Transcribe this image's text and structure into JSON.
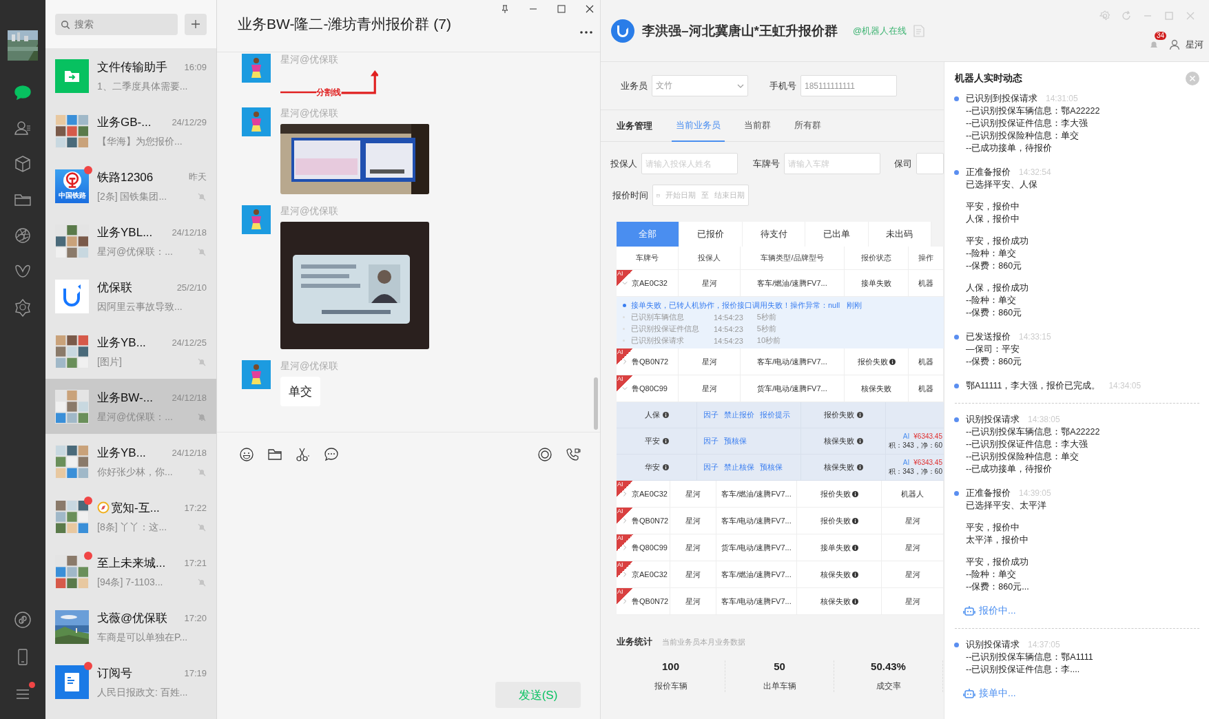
{
  "nav": {
    "items": [
      {
        "kind": "chat",
        "selected": true
      },
      {
        "kind": "contacts",
        "selected": false
      },
      {
        "kind": "cube",
        "selected": false
      },
      {
        "kind": "folder",
        "selected": false
      },
      {
        "kind": "aperture",
        "selected": false
      },
      {
        "kind": "butterfly",
        "selected": false
      },
      {
        "kind": "hexagon",
        "selected": false
      }
    ],
    "bottom": [
      {
        "kind": "link",
        "dot": false
      },
      {
        "kind": "phone",
        "dot": false
      },
      {
        "kind": "menu",
        "dot": true
      }
    ]
  },
  "chat_list": {
    "search": {
      "placeholder": "搜索"
    },
    "items": [
      {
        "name": "文件传输助手",
        "time": "16:09",
        "preview": "1、二季度具体需要...",
        "kind": "file",
        "muted": false,
        "unread": false,
        "selected": false,
        "compass": false
      },
      {
        "name": "业务GB-...",
        "time": "24/12/29",
        "preview": "【华海】为您报价...",
        "kind": "mosaic",
        "muted": false,
        "unread": false,
        "selected": false,
        "compass": false
      },
      {
        "name": "铁路12306",
        "time": "昨天",
        "preview": "[2条] 国铁集团...",
        "kind": "rail",
        "avatar_text": "中国铁路",
        "muted": true,
        "unread": true,
        "selected": false,
        "compass": false
      },
      {
        "name": "业务YBL...",
        "time": "24/12/18",
        "preview": "星河@优保联：...",
        "kind": "mosaic",
        "muted": true,
        "unread": false,
        "selected": false,
        "compass": false
      },
      {
        "name": "优保联",
        "time": "25/2/10",
        "preview": "因阿里云事故导致...",
        "kind": "brand",
        "muted": false,
        "unread": false,
        "selected": false,
        "compass": false
      },
      {
        "name": "业务YB...",
        "time": "24/12/25",
        "preview": "[图片]",
        "kind": "mosaic",
        "muted": true,
        "unread": false,
        "selected": false,
        "compass": false
      },
      {
        "name": "业务BW-...",
        "time": "24/12/18",
        "preview": "星河@优保联：...",
        "kind": "mosaic",
        "muted": true,
        "unread": false,
        "selected": true,
        "compass": false
      },
      {
        "name": "业务YB...",
        "time": "24/12/18",
        "preview": "你好张少林，你...",
        "kind": "mosaic",
        "muted": true,
        "unread": false,
        "selected": false,
        "compass": false
      },
      {
        "name": "宽知-互...",
        "time": "17:22",
        "preview": "[8条] 丫丫：这...",
        "kind": "mosaic",
        "muted": true,
        "unread": true,
        "selected": false,
        "compass": true
      },
      {
        "name": "至上未来城...",
        "time": "17:21",
        "preview": "[94条] 7-1103...",
        "kind": "mosaic",
        "muted": true,
        "unread": true,
        "selected": false,
        "compass": false
      },
      {
        "name": "戈薇@优保联",
        "time": "17:20",
        "preview": "车商是可以单独在P...",
        "muted": false,
        "unread": false,
        "selected": false,
        "compass": false
      },
      {
        "name": "订阅号",
        "time": "17:19",
        "preview": "人民日报政文: 百姓...",
        "kind": "doc",
        "muted": false,
        "unread": true,
        "selected": false,
        "compass": false
      }
    ]
  },
  "chat": {
    "title": "业务BW-隆二-潍坊青州报价群 (7)",
    "messages": [
      {
        "sender": "星河@优保联",
        "kind": "divider",
        "label": "分割线"
      },
      {
        "sender": "星河@优保联",
        "kind": "landscape"
      },
      {
        "sender": "星河@优保联",
        "kind": "portrait"
      },
      {
        "sender": "星河@优保联",
        "kind": "text",
        "text": "单交"
      }
    ],
    "send": "发送(S)"
  },
  "app": {
    "title": "李洪强–河北冀唐山*王虹升报价群",
    "online": "@机器人在线",
    "notifications": "34",
    "user": "星河",
    "salesman": {
      "label": "业务员",
      "value": "文竹"
    },
    "phone": {
      "label": "手机号",
      "value": "185111111111"
    },
    "section": "业务管理",
    "tabs": [
      {
        "label": "当前业务员",
        "selected": true
      },
      {
        "label": "当前群",
        "selected": false
      },
      {
        "label": "所有群",
        "selected": false
      }
    ],
    "filters": {
      "insured": {
        "label": "投保人",
        "placeholder": "请输入投保人姓名"
      },
      "plate": {
        "label": "车牌号",
        "placeholder": "请输入车牌"
      },
      "insurer": {
        "label": "保司"
      },
      "quote_time": {
        "label": "报价时间",
        "start": "开始日期",
        "sep": "至",
        "end": "结束日期"
      }
    },
    "status_tabs": [
      {
        "label": "全部",
        "selected": true
      },
      {
        "label": "已报价",
        "selected": false
      },
      {
        "label": "待支付",
        "selected": false
      },
      {
        "label": "已出单",
        "selected": false
      },
      {
        "label": "未出码",
        "selected": false
      }
    ],
    "table": {
      "columns": [
        "车牌号",
        "投保人",
        "车辆类型/品牌型号",
        "报价状态",
        "操作"
      ],
      "rows": [
        {
          "kind": "wide",
          "tag": "AI",
          "expanded": true,
          "plate": "京AE0C32",
          "insured": "星河",
          "vehicle": "客车/燃油/速腾FV7...",
          "status": "接单失败",
          "info": false,
          "operator": "机器",
          "log": [
            {
              "text": "接单失败，已转人机协作，报价接口调用失败！操作异常：null",
              "time": "刚刚",
              "active": true
            },
            {
              "text": "已识别车辆信息",
              "clock": "14:54:23",
              "time": "5秒前",
              "active": false
            },
            {
              "text": "已识别投保证件信息",
              "clock": "14:54:23",
              "time": "5秒前",
              "active": false
            },
            {
              "text": "已识别投保请求",
              "clock": "14:54:23",
              "time": "10秒前",
              "active": false
            }
          ]
        },
        {
          "kind": "wide",
          "tag": "AI",
          "expanded": false,
          "plate": "鲁QB0N72",
          "insured": "星河",
          "vehicle": "客车/电动/速腾FV7...",
          "status": "报价失败",
          "info": true,
          "operator": "机器"
        },
        {
          "kind": "wide",
          "tag": "AI",
          "expanded": true,
          "plate": "鲁Q80C99",
          "insured": "星河",
          "vehicle": "货车/电动/速腾FV7...",
          "status": "核保失败",
          "info": false,
          "operator": "机器",
          "insurers": [
            {
              "name": "人保",
              "actions": [
                "因子",
                "禁止报价",
                "报价提示"
              ],
              "status": "报价失败"
            },
            {
              "name": "平安",
              "actions": [
                "因子",
                "预核保"
              ],
              "status": "核保失败",
              "tag": "AI",
              "price": "¥6343.45",
              "breakdown": "积：343，净：60"
            },
            {
              "name": "华安",
              "actions": [
                "因子",
                "禁止核保",
                "预核保"
              ],
              "status": "核保失败",
              "tag": "AI",
              "price": "¥6343.45",
              "breakdown": "积：343，净：60"
            }
          ]
        },
        {
          "kind": "compact",
          "tag": "AI",
          "expanded": false,
          "plate": "京AE0C32",
          "insured": "星河",
          "vehicle": "客车/燃油/速腾FV7...",
          "status": "报价失败",
          "info": true,
          "operator": "机器人"
        },
        {
          "kind": "compact",
          "tag": "AI",
          "expanded": false,
          "plate": "鲁QB0N72",
          "insured": "星河",
          "vehicle": "客车/电动/速腾FV7...",
          "status": "报价失败",
          "info": true,
          "operator": "星河"
        },
        {
          "kind": "compact",
          "tag": "AI",
          "expanded": false,
          "plate": "鲁Q80C99",
          "insured": "星河",
          "vehicle": "货车/电动/速腾FV7...",
          "status": "接单失败",
          "info": true,
          "operator": "星河"
        },
        {
          "kind": "compact",
          "tag": "AI",
          "expanded": false,
          "plate": "京AE0C32",
          "insured": "星河",
          "vehicle": "客车/燃油/速腾FV7...",
          "status": "核保失败",
          "info": true,
          "operator": "星河"
        },
        {
          "kind": "compact",
          "tag": "AI",
          "expanded": false,
          "plate": "鲁QB0N72",
          "insured": "星河",
          "vehicle": "客车/电动/速腾FV7...",
          "status": "核保失败",
          "info": true,
          "operator": "星河"
        }
      ]
    },
    "stats": {
      "title": "业务统计",
      "subtitle": "当前业务员本月业务数据",
      "items": [
        {
          "value": "100",
          "label": "报价车辆"
        },
        {
          "value": "50",
          "label": "出单车辆"
        },
        {
          "value": "50.43%",
          "label": "成交率"
        }
      ]
    }
  },
  "robot": {
    "title": "机器人实时动态",
    "groups": [
      {
        "events": [
          {
            "title": "已识别到投保请求",
            "time": "14:31:05",
            "paragraphs": [
              [
                "--已识别投保车辆信息：鄂A22222",
                "--已识别投保证件信息：李大强",
                "--已识别投保险种信息：单交",
                "--已成功接单，待报价"
              ]
            ]
          },
          {
            "title": "正准备报价",
            "time": "14:32:54",
            "paragraphs": [
              [
                "已选择平安、人保"
              ],
              [
                "平安，报价中",
                "人保，报价中"
              ],
              [
                "平安，报价成功",
                "--险种：单交",
                "--保费：860元"
              ],
              [
                "人保，报价成功",
                "--险种：单交",
                "--保费：860元"
              ]
            ]
          },
          {
            "title": "已发送报价",
            "time": "14:33:15",
            "paragraphs": [
              [
                "—保司：平安",
                "--保费：860元"
              ]
            ]
          },
          {
            "title": "鄂A11111，李大强，报价已完成。",
            "time": "14:34:05"
          }
        ]
      },
      {
        "events": [
          {
            "title": "识别投保请求",
            "time": "14:38:05",
            "paragraphs": [
              [
                "--已识别投保车辆信息：鄂A22222",
                "--已识别投保证件信息：李大强",
                "--已识别投保险种信息：单交",
                "--已成功接单，待报价"
              ]
            ]
          },
          {
            "title": "正准备报价",
            "time": "14:39:05",
            "paragraphs": [
              [
                "已选择平安、太平洋"
              ],
              [
                "平安，报价中",
                "太平洋，报价中"
              ],
              [
                "平安，报价成功",
                "--险种：单交",
                "--保费：860元..."
              ]
            ]
          }
        ],
        "status": "报价中..."
      },
      {
        "events": [
          {
            "title": "识别投保请求",
            "time": "14:37:05",
            "paragraphs": [
              [
                "--已识别投保车辆信息：鄂A1111",
                "--已识别投保证件信息：李...."
              ]
            ]
          }
        ],
        "status": "接单中..."
      }
    ]
  }
}
